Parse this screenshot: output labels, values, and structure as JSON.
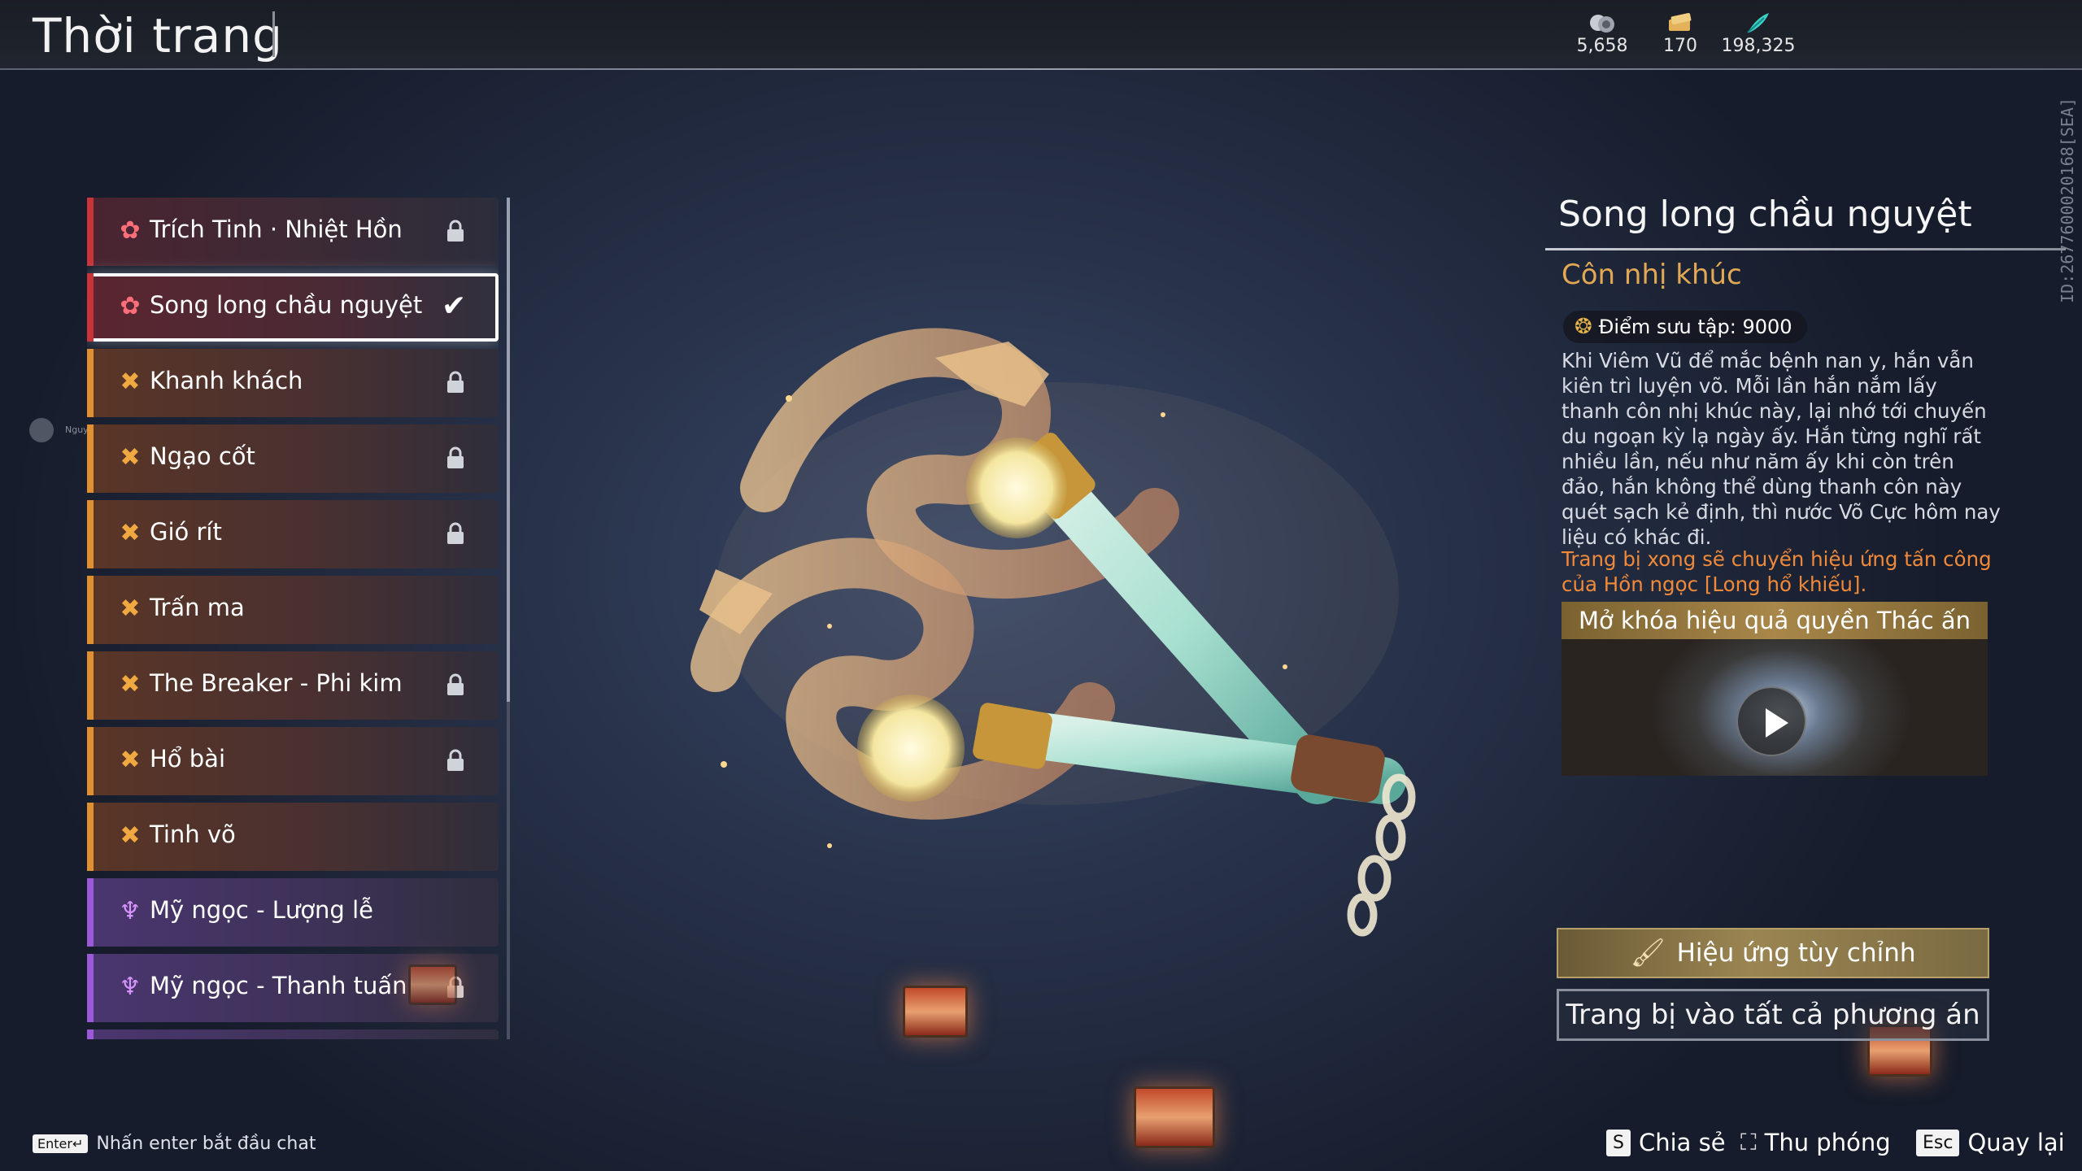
{
  "header": {
    "title": "Thời trang",
    "currencies": [
      {
        "icon": "coin-stack-icon",
        "value": "5,658"
      },
      {
        "icon": "ticket-icon",
        "value": "170"
      },
      {
        "icon": "feather-icon",
        "value": "198,325"
      }
    ],
    "id_text": "ID:2677600020168[SEA]"
  },
  "outfit_list": {
    "items": [
      {
        "label": "Trích Tinh · Nhiệt Hồn",
        "rarity": "red",
        "icon": "flower-star-icon",
        "state": "locked"
      },
      {
        "label": "Song long chầu nguyệt",
        "rarity": "red",
        "icon": "flower-star-icon",
        "state": "selected"
      },
      {
        "label": "Khanh khách",
        "rarity": "orange",
        "icon": "cross-star-icon",
        "state": "locked"
      },
      {
        "label": "Ngạo cốt",
        "rarity": "orange",
        "icon": "cross-star-icon",
        "state": "locked"
      },
      {
        "label": "Gió rít",
        "rarity": "orange",
        "icon": "cross-star-icon",
        "state": "locked"
      },
      {
        "label": "Trấn ma",
        "rarity": "orange",
        "icon": "cross-star-icon",
        "state": "none"
      },
      {
        "label": "The Breaker - Phi kim",
        "rarity": "orange",
        "icon": "cross-star-icon",
        "state": "locked"
      },
      {
        "label": "Hổ bài",
        "rarity": "orange",
        "icon": "cross-star-icon",
        "state": "locked"
      },
      {
        "label": "Tinh võ",
        "rarity": "orange",
        "icon": "cross-star-icon",
        "state": "none"
      },
      {
        "label": "Mỹ ngọc - Lượng lễ",
        "rarity": "purple",
        "icon": "trident-icon",
        "state": "none"
      },
      {
        "label": "Mỹ ngọc - Thanh tuấn",
        "rarity": "purple",
        "icon": "trident-icon",
        "state": "locked"
      }
    ]
  },
  "side_player": {
    "name": "Nguyễn Văn Tú"
  },
  "detail": {
    "title": "Song long chầu nguyệt",
    "subtitle": "Côn nhị khúc",
    "collection_points": "Điểm sưu tập: 9000",
    "description": "Khi Viêm Vũ để mắc bệnh nan y, hắn vẫn kiên trì luyện võ. Mỗi lần hắn nắm lấy thanh côn nhị khúc này, lại nhớ tới chuyến du ngoạn kỳ lạ ngày ấy. Hắn từng nghĩ rất nhiều lần, nếu như năm ấy khi còn trên đảo, hắn không thể dùng thanh côn này quét sạch kẻ định, thì nước Võ Cực hôm nay liệu có khác đi.",
    "effect_note": "Trang bị xong sẽ chuyển hiệu ứng tấn công của Hồn ngọc [Long hổ khiếu].",
    "video_label": "Mở khóa hiệu quả quyền Thác ấn",
    "custom_effect_button": "Hiệu ứng tùy chỉnh",
    "equip_all_button": "Trang bị vào tất cả phương án"
  },
  "footer": {
    "chat_key": "Enter↵",
    "chat_hint": "Nhấn enter bắt đầu chat",
    "share_key": "S",
    "share_label": "Chia sẻ",
    "zoom_label": "Thu phóng",
    "back_key": "Esc",
    "back_label": "Quay lại"
  },
  "colors": {
    "accent_gold": "#e2a854",
    "note_orange": "#f08a3a",
    "rarity_red": "#c9333a",
    "rarity_orange": "#e0902e",
    "rarity_purple": "#9a5ad8"
  }
}
